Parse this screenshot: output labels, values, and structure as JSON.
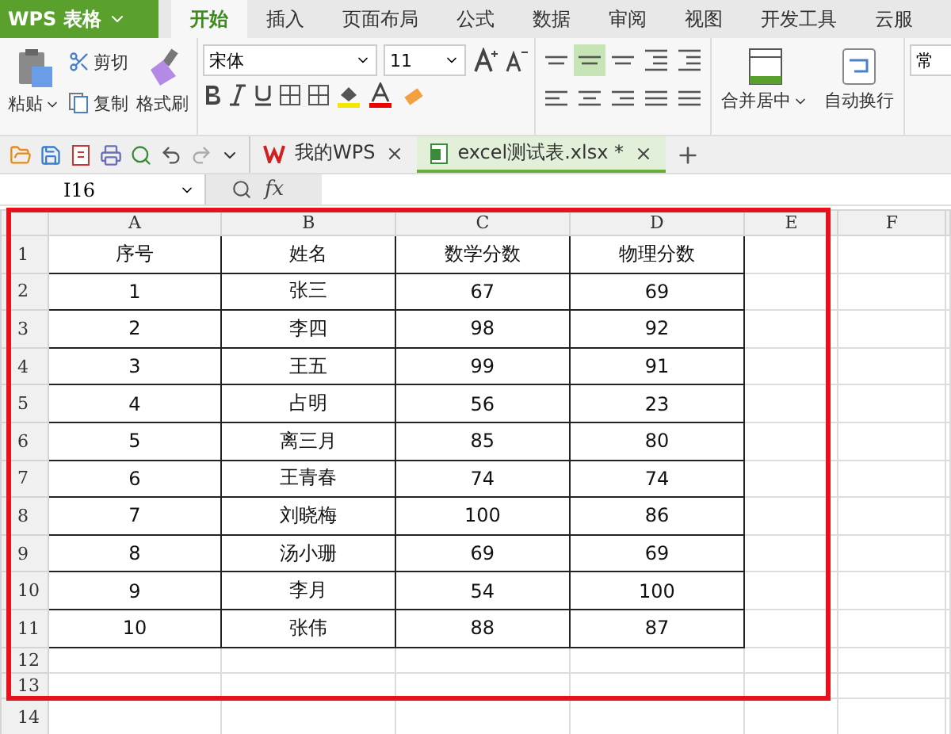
{
  "app": {
    "logo_text": "WPS 表格"
  },
  "menu_tabs": [
    {
      "label": "开始",
      "selected": true
    },
    {
      "label": "插入",
      "selected": false
    },
    {
      "label": "页面布局",
      "selected": false
    },
    {
      "label": "公式",
      "selected": false
    },
    {
      "label": "数据",
      "selected": false
    },
    {
      "label": "审阅",
      "selected": false
    },
    {
      "label": "视图",
      "selected": false
    },
    {
      "label": "开发工具",
      "selected": false
    },
    {
      "label": "云服",
      "selected": false
    }
  ],
  "ribbon": {
    "paste": "粘贴",
    "cut": "剪切",
    "copy": "复制",
    "format_painter": "格式刷",
    "font": "宋体",
    "font_size": "11",
    "align_buttons": [
      {
        "kind": "top",
        "selected": false
      },
      {
        "kind": "middle",
        "selected": true
      },
      {
        "kind": "bottom",
        "selected": false
      },
      {
        "kind": "outdent",
        "selected": false
      },
      {
        "kind": "indent",
        "selected": false
      },
      {
        "kind": "left",
        "selected": false
      },
      {
        "kind": "center",
        "selected": false
      },
      {
        "kind": "right",
        "selected": false
      },
      {
        "kind": "justify",
        "selected": false
      },
      {
        "kind": "distributed",
        "selected": false
      }
    ],
    "merge": "合并居中",
    "wrap": "自动换行",
    "number_format": "常"
  },
  "doc_tabs": [
    {
      "label": "我的WPS",
      "kind": "home",
      "selected": false
    },
    {
      "label": "excel测试表.xlsx *",
      "kind": "sheet",
      "selected": true
    }
  ],
  "formula_bar": {
    "name_box": "I16",
    "fx": "fx"
  },
  "sheet": {
    "columns": [
      "A",
      "B",
      "C",
      "D",
      "E",
      "F"
    ],
    "rows": [
      {
        "num": "1",
        "cells": [
          "序号",
          "姓名",
          "数学分数",
          "物理分数"
        ]
      },
      {
        "num": "2",
        "cells": [
          "1",
          "张三",
          "67",
          "69"
        ]
      },
      {
        "num": "3",
        "cells": [
          "2",
          "李四",
          "98",
          "92"
        ]
      },
      {
        "num": "4",
        "cells": [
          "3",
          "王五",
          "99",
          "91"
        ]
      },
      {
        "num": "5",
        "cells": [
          "4",
          "占明",
          "56",
          "23"
        ]
      },
      {
        "num": "6",
        "cells": [
          "5",
          "离三月",
          "85",
          "80"
        ]
      },
      {
        "num": "7",
        "cells": [
          "6",
          "王青春",
          "74",
          "74"
        ]
      },
      {
        "num": "8",
        "cells": [
          "7",
          "刘晓梅",
          "100",
          "86"
        ]
      },
      {
        "num": "9",
        "cells": [
          "8",
          "汤小珊",
          "69",
          "69"
        ]
      },
      {
        "num": "10",
        "cells": [
          "9",
          "李月",
          "54",
          "100"
        ]
      },
      {
        "num": "11",
        "cells": [
          "10",
          "张伟",
          "88",
          "87"
        ]
      },
      {
        "num": "12",
        "cells": []
      },
      {
        "num": "13",
        "cells": []
      },
      {
        "num": "14",
        "cells": []
      }
    ]
  }
}
